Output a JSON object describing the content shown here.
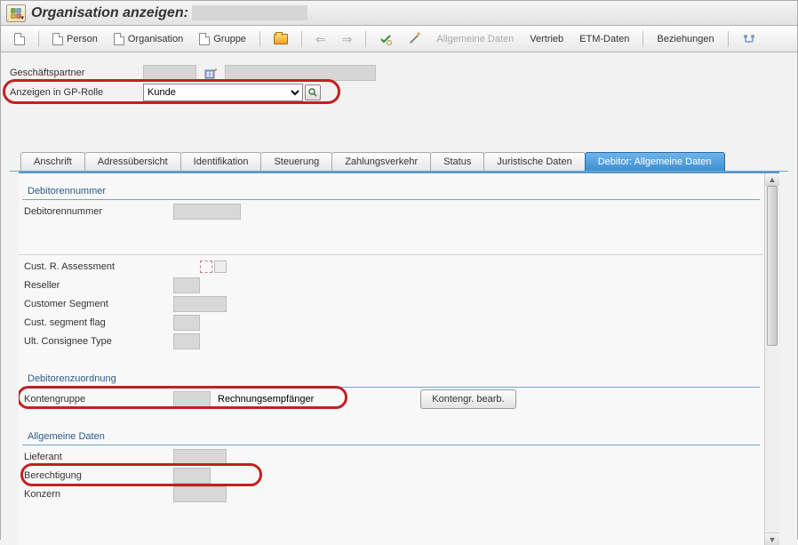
{
  "title": "Organisation anzeigen:",
  "toolbar": {
    "person": "Person",
    "organisation": "Organisation",
    "gruppe": "Gruppe",
    "allgemeine_daten": "Allgemeine Daten",
    "vertrieb": "Vertrieb",
    "etm_daten": "ETM-Daten",
    "beziehungen": "Beziehungen"
  },
  "bp": {
    "label": "Geschäftspartner",
    "role_label": "Anzeigen in GP-Rolle",
    "role_value": "Kunde"
  },
  "tabs": {
    "anschrift": "Anschrift",
    "adressuebersicht": "Adressübersicht",
    "identifikation": "Identifikation",
    "steuerung": "Steuerung",
    "zahlungsverkehr": "Zahlungsverkehr",
    "status": "Status",
    "juristische": "Juristische Daten",
    "debitor_allg": "Debitor: Allgemeine Daten"
  },
  "sections": {
    "debitor_nr": {
      "header": "Debitorennummer",
      "field": "Debitorennummer"
    },
    "assessment": {
      "cust_r": "Cust. R. Assessment",
      "reseller": "Reseller",
      "segment": "Customer Segment",
      "seg_flag": "Cust. segment flag",
      "consignee": "Ult. Consignee Type"
    },
    "zuordnung": {
      "header": "Debitorenzuordnung",
      "kontengruppe": "Kontengruppe",
      "kontengruppe_text": "Rechnungsempfänger",
      "btn": "Kontengr. bearb."
    },
    "allgemein": {
      "header": "Allgemeine Daten",
      "lieferant": "Lieferant",
      "berechtigung": "Berechtigung",
      "konzern": "Konzern"
    }
  }
}
